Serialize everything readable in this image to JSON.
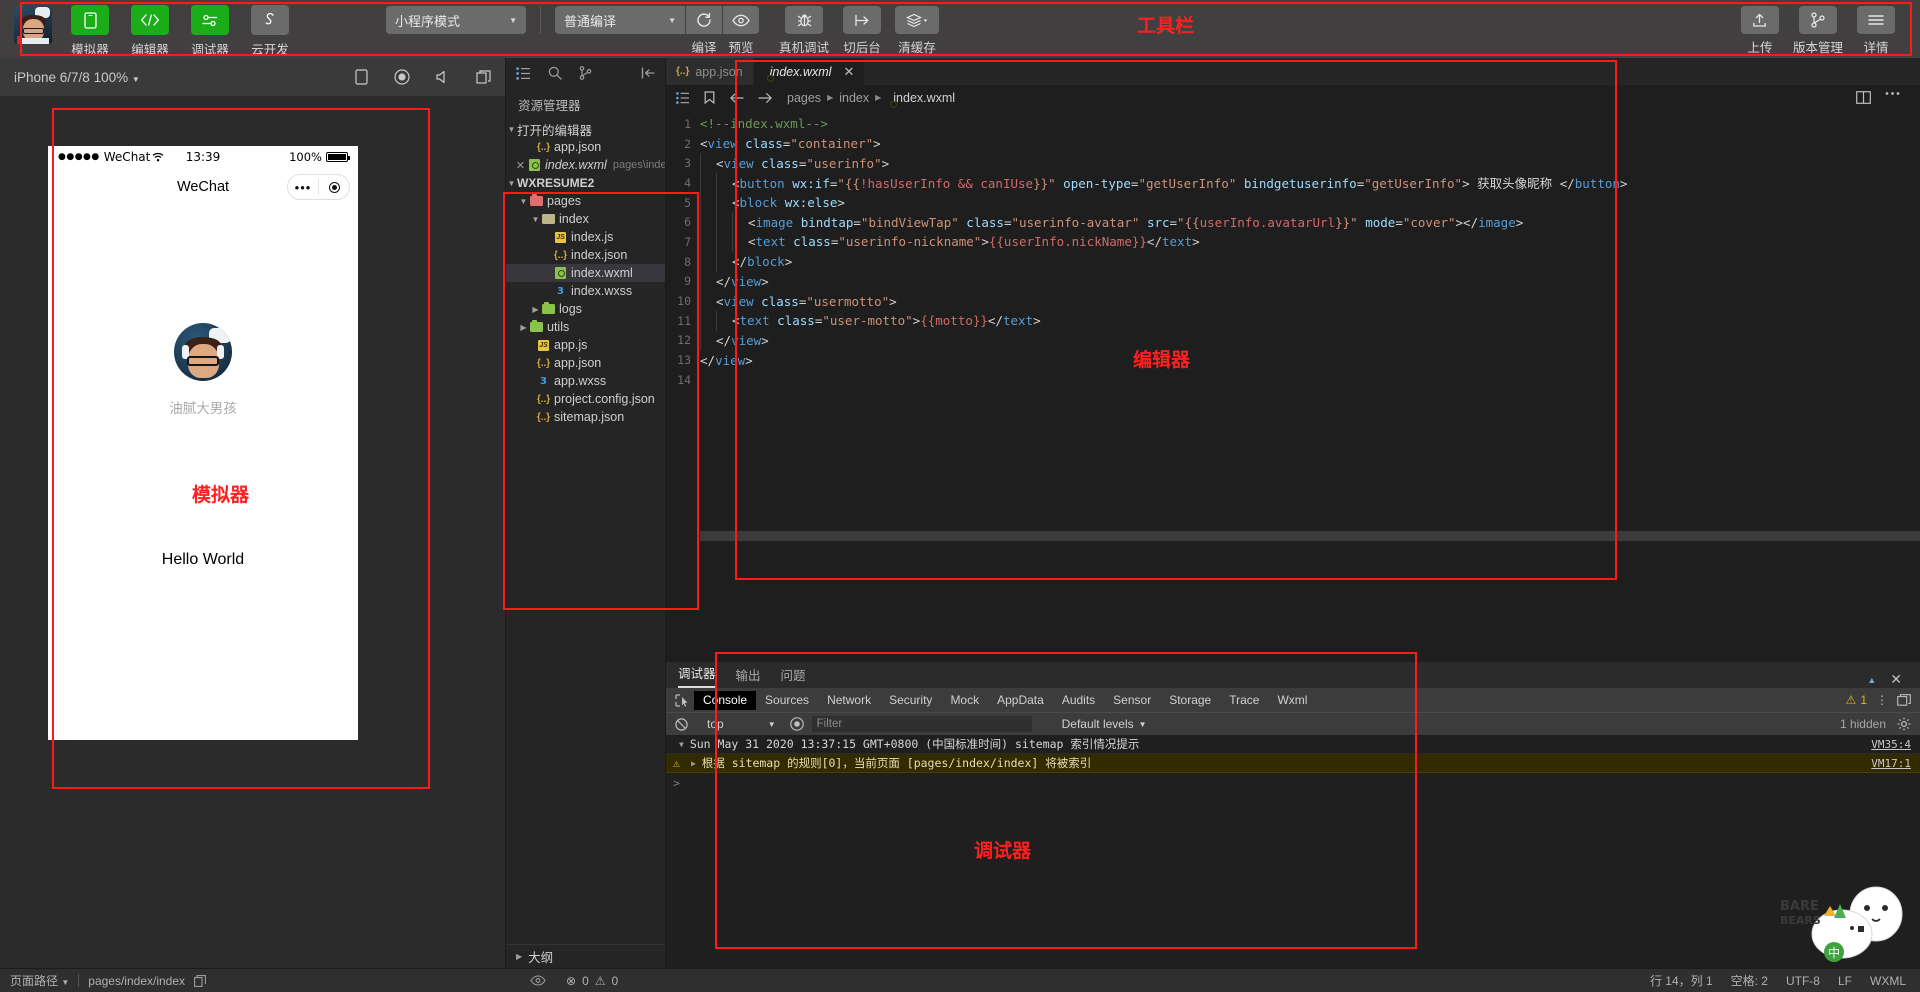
{
  "toolbar": {
    "left_buttons": [
      {
        "label": "模拟器",
        "icon": "phone-icon",
        "active": true
      },
      {
        "label": "编辑器",
        "icon": "code-icon",
        "active": true
      },
      {
        "label": "调试器",
        "icon": "debugger-icon",
        "active": true
      },
      {
        "label": "云开发",
        "icon": "cloud-icon",
        "active": false
      }
    ],
    "mode_select": "小程序模式",
    "compile_select": "普通编译",
    "compile_label": "编译",
    "preview_label": "预览",
    "remote_debug_label": "真机调试",
    "background_label": "切后台",
    "clear_cache_label": "清缓存",
    "upload_label": "上传",
    "version_label": "版本管理",
    "detail_label": "详情",
    "annotation": "工具栏"
  },
  "simulator": {
    "device": "iPhone 6/7/8 100%",
    "annotation": "模拟器",
    "phone": {
      "carrier": "WeChat",
      "signal_dots": "●●●●●",
      "time": "13:39",
      "battery_percent": "100%",
      "nav_title": "WeChat",
      "capsule_more": "•••",
      "nickname": "油腻大男孩",
      "motto": "Hello World"
    }
  },
  "explorer": {
    "title": "资源管理器",
    "open_editors_label": "打开的编辑器",
    "open_editors": [
      {
        "name": "app.json",
        "icon": "json-icon",
        "path": ""
      },
      {
        "name": "index.wxml",
        "icon": "wxml-icon",
        "path": "pages\\index",
        "active": true
      }
    ],
    "project_name": "WXRESUME2",
    "tree": [
      {
        "name": "pages",
        "icon": "folder-pink-icon",
        "depth": 1,
        "expanded": true
      },
      {
        "name": "index",
        "icon": "folder-icon",
        "depth": 2,
        "expanded": true
      },
      {
        "name": "index.js",
        "icon": "js-icon",
        "depth": 3
      },
      {
        "name": "index.json",
        "icon": "json-icon",
        "depth": 3
      },
      {
        "name": "index.wxml",
        "icon": "wxml-icon",
        "depth": 3,
        "selected": true
      },
      {
        "name": "index.wxss",
        "icon": "wxss-icon",
        "depth": 3
      },
      {
        "name": "logs",
        "icon": "folder-icon",
        "depth": 1,
        "expanded": false
      },
      {
        "name": "utils",
        "icon": "folder-icon",
        "depth": 1,
        "expanded": false
      },
      {
        "name": "app.js",
        "icon": "js-icon",
        "depth": 1
      },
      {
        "name": "app.json",
        "icon": "json-icon",
        "depth": 1
      },
      {
        "name": "app.wxss",
        "icon": "wxss-icon",
        "depth": 1
      },
      {
        "name": "project.config.json",
        "icon": "json-icon",
        "depth": 1
      },
      {
        "name": "sitemap.json",
        "icon": "json-icon",
        "depth": 1
      }
    ],
    "outline_label": "大纲"
  },
  "editor": {
    "annotation": "编辑器",
    "tabs": [
      {
        "label": "app.json",
        "icon": "json-icon",
        "active": false
      },
      {
        "label": "index.wxml",
        "icon": "wxml-icon",
        "active": true,
        "closable": true
      }
    ],
    "breadcrumb": [
      "pages",
      "index",
      "index.wxml"
    ],
    "lines": [
      {
        "n": "1",
        "html": "<span class='cmt'>&lt;!--index.wxml--&gt;</span>",
        "indent": 0
      },
      {
        "n": "2",
        "html": "<span class='brc'>&lt;</span><span class='tag'>view</span> <span class='attr'>class</span><span class='brc'>=</span><span class='str'>\"container\"</span><span class='brc'>&gt;</span>",
        "indent": 0
      },
      {
        "n": "3",
        "html": "<span class='brc'>&lt;</span><span class='tag'>view</span> <span class='attr'>class</span><span class='brc'>=</span><span class='str'>\"userinfo\"</span><span class='brc'>&gt;</span>",
        "indent": 1
      },
      {
        "n": "4",
        "html": "<span class='brc'>&lt;</span><span class='tag'>button</span> <span class='attr'>wx:if</span><span class='brc'>=</span><span class='str'>\"{{</span><span class='mus'>!hasUserInfo &amp;&amp; canIUse</span><span class='str'>}}\"</span> <span class='attr'>open-type</span><span class='brc'>=</span><span class='str'>\"getUserInfo\"</span> <span class='attr'>bindgetuserinfo</span><span class='brc'>=</span><span class='str'>\"getUserInfo\"</span><span class='brc'>&gt;</span> <span class='cn'>获取头像昵称</span> <span class='brc'>&lt;/</span><span class='tag'>button</span><span class='brc'>&gt;</span>",
        "indent": 2
      },
      {
        "n": "5",
        "html": "<span class='brc'>&lt;</span><span class='tag'>block</span> <span class='attr'>wx:else</span><span class='brc'>&gt;</span>",
        "indent": 2
      },
      {
        "n": "6",
        "html": "<span class='brc'>&lt;</span><span class='tag'>image</span> <span class='attr'>bindtap</span><span class='brc'>=</span><span class='str'>\"bindViewTap\"</span> <span class='attr'>class</span><span class='brc'>=</span><span class='str'>\"userinfo-avatar\"</span> <span class='attr'>src</span><span class='brc'>=</span><span class='str'>\"{{</span><span class='mus'>userInfo.avatarUrl</span><span class='str'>}}\"</span> <span class='attr'>mode</span><span class='brc'>=</span><span class='str'>\"cover\"</span><span class='brc'>&gt;&lt;/</span><span class='tag'>image</span><span class='brc'>&gt;</span>",
        "indent": 3
      },
      {
        "n": "7",
        "html": "<span class='brc'>&lt;</span><span class='tag'>text</span> <span class='attr'>class</span><span class='brc'>=</span><span class='str'>\"userinfo-nickname\"</span><span class='brc'>&gt;</span><span class='mus'>{{userInfo.nickName}}</span><span class='brc'>&lt;/</span><span class='tag'>text</span><span class='brc'>&gt;</span>",
        "indent": 3
      },
      {
        "n": "8",
        "html": "<span class='brc'>&lt;/</span><span class='tag'>block</span><span class='brc'>&gt;</span>",
        "indent": 2
      },
      {
        "n": "9",
        "html": "<span class='brc'>&lt;/</span><span class='tag'>view</span><span class='brc'>&gt;</span>",
        "indent": 1
      },
      {
        "n": "10",
        "html": "<span class='brc'>&lt;</span><span class='tag'>view</span> <span class='attr'>class</span><span class='brc'>=</span><span class='str'>\"usermotto\"</span><span class='brc'>&gt;</span>",
        "indent": 1
      },
      {
        "n": "11",
        "html": "<span class='brc'>&lt;</span><span class='tag'>text</span> <span class='attr'>class</span><span class='brc'>=</span><span class='str'>\"user-motto\"</span><span class='brc'>&gt;</span><span class='mus'>{{motto}}</span><span class='brc'>&lt;/</span><span class='tag'>text</span><span class='brc'>&gt;</span>",
        "indent": 2
      },
      {
        "n": "12",
        "html": "<span class='brc'>&lt;/</span><span class='tag'>view</span><span class='brc'>&gt;</span>",
        "indent": 1
      },
      {
        "n": "13",
        "html": "<span class='brc'>&lt;/</span><span class='tag'>view</span><span class='brc'>&gt;</span>",
        "indent": 0
      },
      {
        "n": "14",
        "html": "",
        "indent": 0
      }
    ]
  },
  "console": {
    "annotation": "调试器",
    "panel_tabs": [
      {
        "label": "调试器",
        "active": true
      },
      {
        "label": "输出",
        "active": false
      },
      {
        "label": "问题",
        "active": false
      }
    ],
    "devtools_tabs": [
      "Console",
      "Sources",
      "Network",
      "Security",
      "Mock",
      "AppData",
      "Audits",
      "Sensor",
      "Storage",
      "Trace",
      "Wxml"
    ],
    "active_devtools_tab": "Console",
    "warning_count": "1",
    "context": "top",
    "filter_placeholder": "Filter",
    "levels": "Default levels",
    "hidden_label": "1 hidden",
    "messages": [
      {
        "text": "Sun May 31 2020 13:37:15 GMT+0800 (中国标准时间) sitemap 索引情况提示",
        "vm": "VM35:4",
        "level": "info"
      },
      {
        "text": "根据 sitemap 的规则[0]，当前页面 [pages/index/index] 将被索引",
        "vm": "VM17:1",
        "level": "warning"
      }
    ]
  },
  "statusbar": {
    "page_path_label": "页面路径",
    "page_path": "pages/index/index",
    "errors": "0",
    "warnings": "0",
    "position": "行 14，列 1",
    "spaces": "空格: 2",
    "encoding": "UTF-8",
    "eol": "LF",
    "language": "WXML"
  }
}
